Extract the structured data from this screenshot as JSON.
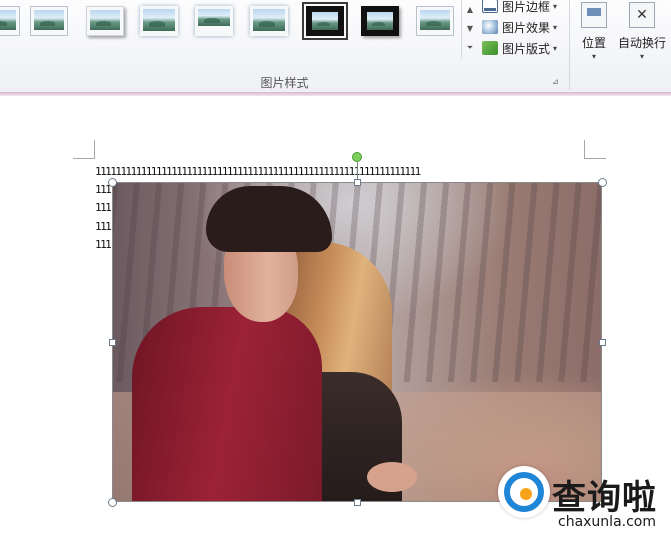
{
  "ribbon": {
    "group_label": "图片样式",
    "commands": {
      "border_label": "图片边框",
      "effect_label": "图片效果",
      "layout_label": "图片版式"
    },
    "arrange": {
      "position_label": "位置",
      "wrap_label": "自动换行"
    },
    "icons": {
      "border": "picture-border-icon",
      "effect": "picture-effect-icon",
      "layout": "picture-layout-icon",
      "position": "position-icon",
      "wrap": "wrap-text-icon",
      "dropdown": "chevron-down-icon",
      "launcher": "dialog-launcher-icon"
    }
  },
  "document": {
    "lines": [
      "1111111111111111111111111111111111111111111111111111111111111111",
      "111",
      "111",
      "111",
      "111"
    ]
  },
  "watermark": {
    "title": "查询啦",
    "url": "chaxunla.com"
  }
}
